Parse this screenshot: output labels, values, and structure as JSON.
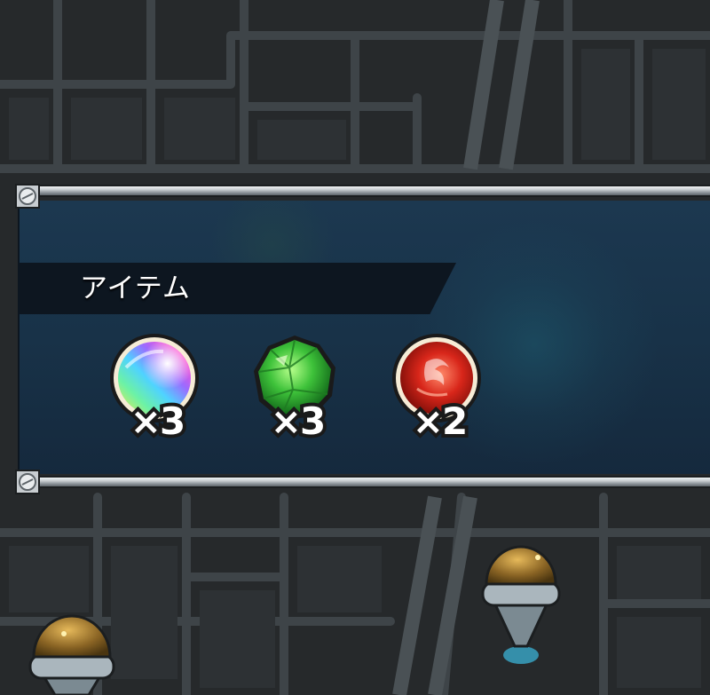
{
  "panel": {
    "title": "アイテム",
    "items": [
      {
        "icon": "rainbow-orb-icon",
        "quantity": "×3"
      },
      {
        "icon": "green-crystal-icon",
        "quantity": "×3"
      },
      {
        "icon": "red-fire-orb-icon",
        "quantity": "×2"
      }
    ]
  },
  "colors": {
    "map_background": "#26292b",
    "map_roads": "#40464a",
    "panel_background": "#183248",
    "header_bar": "#0d1620",
    "rail_silver": "#c3c9cd"
  }
}
